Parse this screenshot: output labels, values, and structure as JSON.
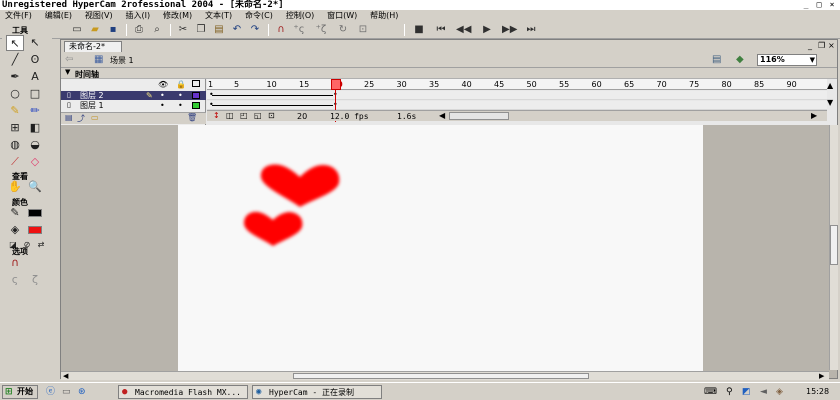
{
  "window": {
    "title": "Unregistered HyperCam 2rofessional 2004 - [未命名-2*]",
    "controls": [
      "_",
      "□",
      "×"
    ]
  },
  "menubar": [
    "文件(F)",
    "编辑(E)",
    "视图(V)",
    "插入(I)",
    "修改(M)",
    "文本(T)",
    "命令(C)",
    "控制(O)",
    "窗口(W)",
    "帮助(H)"
  ],
  "toolbar_icons": [
    "new-icon",
    "open-icon",
    "save-icon",
    "print-icon",
    "print-preview-icon",
    "cut-icon",
    "copy-icon",
    "paste-icon",
    "undo-icon",
    "redo-icon",
    "magnet-icon",
    "smooth-icon",
    "straighten-icon",
    "rotate-icon",
    "scale-icon",
    "stop-icon",
    "rewind-icon",
    "step-back-icon",
    "play-icon",
    "step-forward-icon",
    "go-end-icon"
  ],
  "tools_panel": {
    "title": "工具",
    "view_label": "查看",
    "colors_label": "颜色",
    "options_label": "选项",
    "stroke_color": "#000000",
    "fill_color": "#ee1111"
  },
  "document": {
    "tab_label": "未命名-2*",
    "scene_label": "场景 1",
    "zoom": "116%"
  },
  "timeline": {
    "label": "时间轴",
    "layers": [
      {
        "name": "图层 2",
        "color": "#6633cc",
        "selected": true
      },
      {
        "name": "图层 1",
        "color": "#33cc33",
        "selected": false
      }
    ],
    "ruler_labels": [
      "1",
      "5",
      "10",
      "15",
      "20",
      "25",
      "30",
      "35",
      "40",
      "45",
      "50",
      "55",
      "60",
      "65",
      "70",
      "75",
      "80",
      "85",
      "90"
    ],
    "current_frame": "20",
    "fps": "12.0 fps",
    "time": "1.6s"
  },
  "stage": {
    "background": "#f8f8f8",
    "shape_color": "#ff0000",
    "shapes": [
      "heart-large",
      "heart-small"
    ]
  },
  "taskbar": {
    "start_label": "开始",
    "tasks": [
      "Macromedia Flash MX...",
      "HyperCam - 正在录制"
    ],
    "clock": "15:28"
  }
}
